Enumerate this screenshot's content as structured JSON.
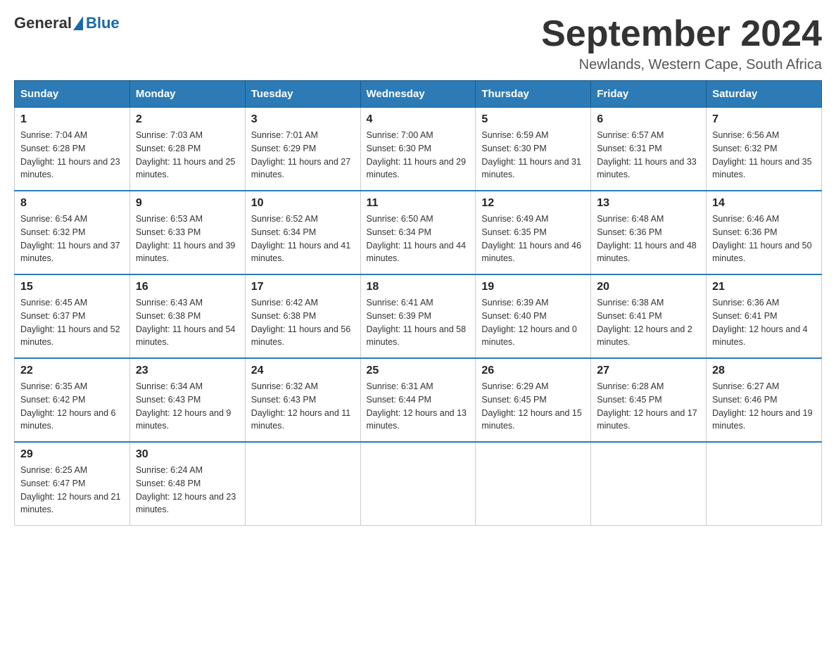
{
  "header": {
    "logo": {
      "general": "General",
      "blue": "Blue"
    },
    "title": "September 2024",
    "location": "Newlands, Western Cape, South Africa"
  },
  "weekdays": [
    "Sunday",
    "Monday",
    "Tuesday",
    "Wednesday",
    "Thursday",
    "Friday",
    "Saturday"
  ],
  "weeks": [
    [
      {
        "day": "1",
        "sunrise": "Sunrise: 7:04 AM",
        "sunset": "Sunset: 6:28 PM",
        "daylight": "Daylight: 11 hours and 23 minutes."
      },
      {
        "day": "2",
        "sunrise": "Sunrise: 7:03 AM",
        "sunset": "Sunset: 6:28 PM",
        "daylight": "Daylight: 11 hours and 25 minutes."
      },
      {
        "day": "3",
        "sunrise": "Sunrise: 7:01 AM",
        "sunset": "Sunset: 6:29 PM",
        "daylight": "Daylight: 11 hours and 27 minutes."
      },
      {
        "day": "4",
        "sunrise": "Sunrise: 7:00 AM",
        "sunset": "Sunset: 6:30 PM",
        "daylight": "Daylight: 11 hours and 29 minutes."
      },
      {
        "day": "5",
        "sunrise": "Sunrise: 6:59 AM",
        "sunset": "Sunset: 6:30 PM",
        "daylight": "Daylight: 11 hours and 31 minutes."
      },
      {
        "day": "6",
        "sunrise": "Sunrise: 6:57 AM",
        "sunset": "Sunset: 6:31 PM",
        "daylight": "Daylight: 11 hours and 33 minutes."
      },
      {
        "day": "7",
        "sunrise": "Sunrise: 6:56 AM",
        "sunset": "Sunset: 6:32 PM",
        "daylight": "Daylight: 11 hours and 35 minutes."
      }
    ],
    [
      {
        "day": "8",
        "sunrise": "Sunrise: 6:54 AM",
        "sunset": "Sunset: 6:32 PM",
        "daylight": "Daylight: 11 hours and 37 minutes."
      },
      {
        "day": "9",
        "sunrise": "Sunrise: 6:53 AM",
        "sunset": "Sunset: 6:33 PM",
        "daylight": "Daylight: 11 hours and 39 minutes."
      },
      {
        "day": "10",
        "sunrise": "Sunrise: 6:52 AM",
        "sunset": "Sunset: 6:34 PM",
        "daylight": "Daylight: 11 hours and 41 minutes."
      },
      {
        "day": "11",
        "sunrise": "Sunrise: 6:50 AM",
        "sunset": "Sunset: 6:34 PM",
        "daylight": "Daylight: 11 hours and 44 minutes."
      },
      {
        "day": "12",
        "sunrise": "Sunrise: 6:49 AM",
        "sunset": "Sunset: 6:35 PM",
        "daylight": "Daylight: 11 hours and 46 minutes."
      },
      {
        "day": "13",
        "sunrise": "Sunrise: 6:48 AM",
        "sunset": "Sunset: 6:36 PM",
        "daylight": "Daylight: 11 hours and 48 minutes."
      },
      {
        "day": "14",
        "sunrise": "Sunrise: 6:46 AM",
        "sunset": "Sunset: 6:36 PM",
        "daylight": "Daylight: 11 hours and 50 minutes."
      }
    ],
    [
      {
        "day": "15",
        "sunrise": "Sunrise: 6:45 AM",
        "sunset": "Sunset: 6:37 PM",
        "daylight": "Daylight: 11 hours and 52 minutes."
      },
      {
        "day": "16",
        "sunrise": "Sunrise: 6:43 AM",
        "sunset": "Sunset: 6:38 PM",
        "daylight": "Daylight: 11 hours and 54 minutes."
      },
      {
        "day": "17",
        "sunrise": "Sunrise: 6:42 AM",
        "sunset": "Sunset: 6:38 PM",
        "daylight": "Daylight: 11 hours and 56 minutes."
      },
      {
        "day": "18",
        "sunrise": "Sunrise: 6:41 AM",
        "sunset": "Sunset: 6:39 PM",
        "daylight": "Daylight: 11 hours and 58 minutes."
      },
      {
        "day": "19",
        "sunrise": "Sunrise: 6:39 AM",
        "sunset": "Sunset: 6:40 PM",
        "daylight": "Daylight: 12 hours and 0 minutes."
      },
      {
        "day": "20",
        "sunrise": "Sunrise: 6:38 AM",
        "sunset": "Sunset: 6:41 PM",
        "daylight": "Daylight: 12 hours and 2 minutes."
      },
      {
        "day": "21",
        "sunrise": "Sunrise: 6:36 AM",
        "sunset": "Sunset: 6:41 PM",
        "daylight": "Daylight: 12 hours and 4 minutes."
      }
    ],
    [
      {
        "day": "22",
        "sunrise": "Sunrise: 6:35 AM",
        "sunset": "Sunset: 6:42 PM",
        "daylight": "Daylight: 12 hours and 6 minutes."
      },
      {
        "day": "23",
        "sunrise": "Sunrise: 6:34 AM",
        "sunset": "Sunset: 6:43 PM",
        "daylight": "Daylight: 12 hours and 9 minutes."
      },
      {
        "day": "24",
        "sunrise": "Sunrise: 6:32 AM",
        "sunset": "Sunset: 6:43 PM",
        "daylight": "Daylight: 12 hours and 11 minutes."
      },
      {
        "day": "25",
        "sunrise": "Sunrise: 6:31 AM",
        "sunset": "Sunset: 6:44 PM",
        "daylight": "Daylight: 12 hours and 13 minutes."
      },
      {
        "day": "26",
        "sunrise": "Sunrise: 6:29 AM",
        "sunset": "Sunset: 6:45 PM",
        "daylight": "Daylight: 12 hours and 15 minutes."
      },
      {
        "day": "27",
        "sunrise": "Sunrise: 6:28 AM",
        "sunset": "Sunset: 6:45 PM",
        "daylight": "Daylight: 12 hours and 17 minutes."
      },
      {
        "day": "28",
        "sunrise": "Sunrise: 6:27 AM",
        "sunset": "Sunset: 6:46 PM",
        "daylight": "Daylight: 12 hours and 19 minutes."
      }
    ],
    [
      {
        "day": "29",
        "sunrise": "Sunrise: 6:25 AM",
        "sunset": "Sunset: 6:47 PM",
        "daylight": "Daylight: 12 hours and 21 minutes."
      },
      {
        "day": "30",
        "sunrise": "Sunrise: 6:24 AM",
        "sunset": "Sunset: 6:48 PM",
        "daylight": "Daylight: 12 hours and 23 minutes."
      },
      null,
      null,
      null,
      null,
      null
    ]
  ]
}
